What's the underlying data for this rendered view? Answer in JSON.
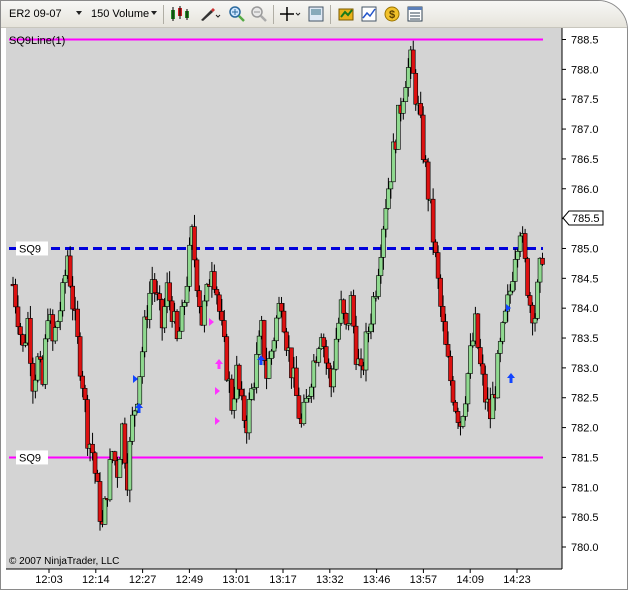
{
  "toolbar": {
    "instrument": "ER2 09-07",
    "period": "150 Volume"
  },
  "chart_title": "SQ9Line(1)",
  "copyright": "© 2007 NinjaTrader, LLC",
  "current_price_label": "785.5",
  "colors": {
    "background": "#d4d4d4",
    "up_candle": "#8fd98f",
    "down_candle": "#dd1111",
    "sq9_line": "#ff00ff",
    "sq9_dashed": "#0000dd",
    "signal_magenta": "#ff33ff",
    "signal_blue": "#1144ff"
  },
  "chart_data": {
    "type": "candlestick",
    "y_axis": {
      "min": 779.8,
      "max": 788.6,
      "ticks": [
        "788.5",
        "788.0",
        "787.5",
        "787.0",
        "786.5",
        "786.0",
        "785.5",
        "785.0",
        "784.5",
        "784.0",
        "783.5",
        "783.0",
        "782.5",
        "782.0",
        "781.5",
        "781.0",
        "780.5",
        "780.0"
      ]
    },
    "x_axis": {
      "ticks": [
        "12:03",
        "12:14",
        "12:27",
        "12:49",
        "13:01",
        "13:17",
        "13:32",
        "13:46",
        "13:57",
        "14:09",
        "14:23"
      ]
    },
    "horizontal_lines": [
      {
        "label": "",
        "value": 788.5,
        "style": "solid",
        "color": "#ff00ff"
      },
      {
        "label": "SQ9",
        "value": 785.0,
        "style": "dashed",
        "color": "#0000dd"
      },
      {
        "label": "SQ9",
        "value": 781.5,
        "style": "solid",
        "color": "#ff00ff"
      }
    ],
    "close_path": [
      784.4,
      783.9,
      783.3,
      783.8,
      782.8,
      783.1,
      782.7,
      784.0,
      783.4,
      783.8,
      784.2,
      784.9,
      784.1,
      783.4,
      782.8,
      781.9,
      781.6,
      780.9,
      780.3,
      781.0,
      781.6,
      781.3,
      782.0,
      781.2,
      782.1,
      782.6,
      783.3,
      784.0,
      784.5,
      784.1,
      783.7,
      784.3,
      784.0,
      783.4,
      783.8,
      784.5,
      785.2,
      784.5,
      783.8,
      784.2,
      784.8,
      784.3,
      783.6,
      783.0,
      782.4,
      782.9,
      782.3,
      782.1,
      782.6,
      783.1,
      783.6,
      782.9,
      783.3,
      783.8,
      784.2,
      783.5,
      783.0,
      782.5,
      782.0,
      782.4,
      782.9,
      783.3,
      783.7,
      783.1,
      782.7,
      783.5,
      784.0,
      783.6,
      784.1,
      783.3,
      782.8,
      783.4,
      783.9,
      784.4,
      785.1,
      785.8,
      786.3,
      786.9,
      787.4,
      787.9,
      788.1,
      787.6,
      787.0,
      786.3,
      785.6,
      784.8,
      784.0,
      783.3,
      782.8,
      782.4,
      782.1,
      782.6,
      783.2,
      783.7,
      783.0,
      782.5,
      782.2,
      782.7,
      783.3,
      783.8,
      784.3,
      785.0,
      785.4,
      784.7,
      784.1,
      783.9,
      784.6,
      785.3
    ]
  }
}
